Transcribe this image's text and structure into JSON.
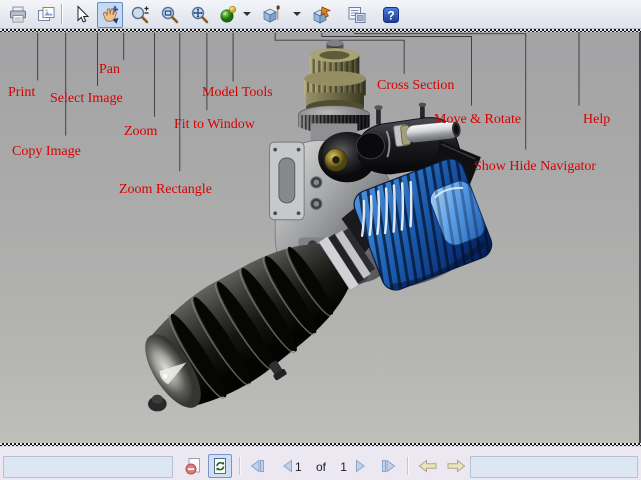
{
  "toolbar": {
    "tools": [
      {
        "name": "print"
      },
      {
        "name": "copy-image"
      },
      {
        "name": "select"
      },
      {
        "name": "pan",
        "selected": true
      },
      {
        "name": "zoom"
      },
      {
        "name": "zoom-rectangle"
      },
      {
        "name": "fit-to-window"
      },
      {
        "name": "model-tools",
        "has_dropdown": true
      },
      {
        "name": "cross-section",
        "has_dropdown": true
      },
      {
        "name": "move-rotate"
      },
      {
        "name": "show-hide-navigator"
      },
      {
        "name": "help"
      }
    ]
  },
  "annotations": {
    "color": "#d90000",
    "items": [
      {
        "label": "Print"
      },
      {
        "label": "Copy Image"
      },
      {
        "label": "Select Image"
      },
      {
        "label": "Pan"
      },
      {
        "label": "Zoom"
      },
      {
        "label": "Zoom Rectangle"
      },
      {
        "label": "Fit to Window"
      },
      {
        "label": "Model Tools"
      },
      {
        "label": "Cross Section"
      },
      {
        "label": "Move & Rotate"
      },
      {
        "label": "Show Hide Navigator"
      },
      {
        "label": "Help"
      }
    ]
  },
  "viewport": {
    "model": "rc-glow-engine-with-blue-finned-head-and-black-muffler"
  },
  "pager": {
    "current": "1",
    "separator": "of",
    "total": "1"
  },
  "colors": {
    "annotation_red": "#d90000",
    "engine_blue": "#1b5cae",
    "engine_olive": "#8f8a5f",
    "selection_border": "#6a8cc0",
    "toolbar_bg": "#e7eaf1",
    "statusbar_bg": "#ebe8f1",
    "canvas_gray": "#aaaaaa"
  }
}
